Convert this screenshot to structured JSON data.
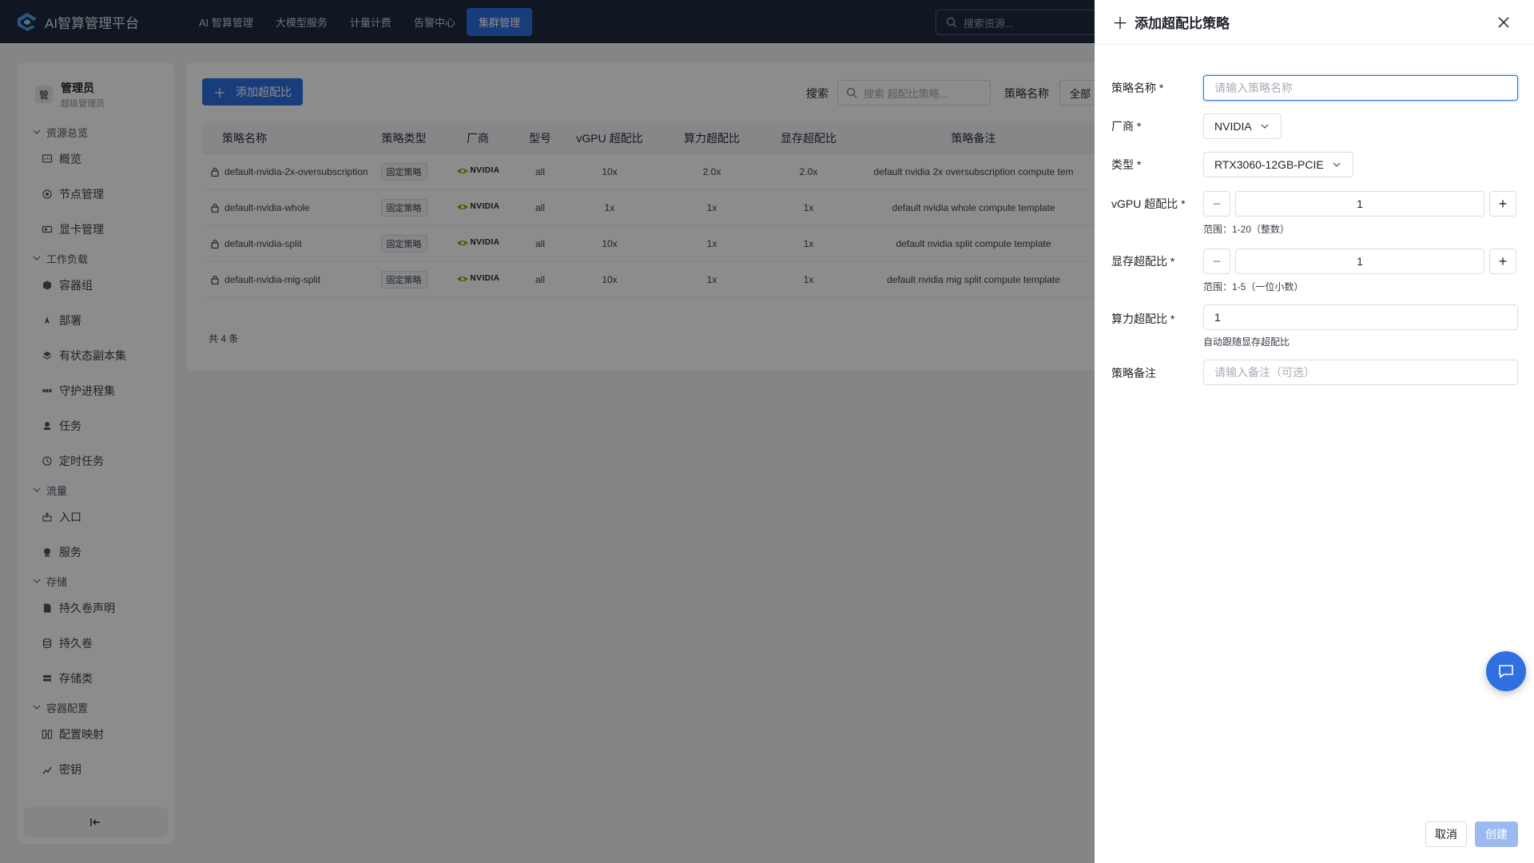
{
  "app": {
    "title": "AI智算管理平台"
  },
  "nav": [
    {
      "label": "AI 智算管理"
    },
    {
      "label": "大模型服务"
    },
    {
      "label": "计量计费"
    },
    {
      "label": "告警中心"
    },
    {
      "label": "集群管理",
      "active": true
    }
  ],
  "top_search": {
    "placeholder": "搜索资源..."
  },
  "user": {
    "avatar": "管",
    "name": "管理员",
    "role": "超级管理员"
  },
  "sidebar": {
    "sections": [
      {
        "label": "资源总览",
        "items": [
          {
            "label": "概览",
            "icon": "grid-icon"
          },
          {
            "label": "节点管理",
            "icon": "node-icon"
          },
          {
            "label": "显卡管理",
            "icon": "gpu-icon"
          }
        ]
      },
      {
        "label": "工作负载",
        "items": [
          {
            "label": "容器组",
            "icon": "cube-icon"
          },
          {
            "label": "部署",
            "icon": "deploy-icon"
          },
          {
            "label": "有状态副本集",
            "icon": "layers-icon"
          },
          {
            "label": "守护进程集",
            "icon": "daemon-icon"
          },
          {
            "label": "任务",
            "icon": "job-icon"
          },
          {
            "label": "定时任务",
            "icon": "clock-icon"
          }
        ]
      },
      {
        "label": "流量",
        "items": [
          {
            "label": "入口",
            "icon": "ingress-icon"
          },
          {
            "label": "服务",
            "icon": "service-icon"
          }
        ]
      },
      {
        "label": "存储",
        "items": [
          {
            "label": "持久卷声明",
            "icon": "file-icon"
          },
          {
            "label": "持久卷",
            "icon": "database-icon"
          },
          {
            "label": "存储类",
            "icon": "storage-icon"
          }
        ]
      },
      {
        "label": "容器配置",
        "items": [
          {
            "label": "配置映射",
            "icon": "config-icon"
          },
          {
            "label": "密钥",
            "icon": "key-icon"
          }
        ]
      }
    ]
  },
  "toolbar": {
    "add_label": "添加超配比",
    "search_label": "搜索",
    "search_placeholder": "搜索 超配比策略...",
    "name_filter_label": "策略名称",
    "name_filter_value": "全部"
  },
  "table": {
    "columns": [
      "策略名称",
      "策略类型",
      "厂商",
      "型号",
      "vGPU 超配比",
      "算力超配比",
      "显存超配比",
      "策略备注"
    ],
    "rows": [
      {
        "name": "default-nvidia-2x-oversubscription",
        "type": "固定策略",
        "vendor": "NVIDIA",
        "model": "all",
        "vgpu": "10x",
        "compute": "2.0x",
        "memory": "2.0x",
        "note": "default nvidia 2x oversubscription compute tem"
      },
      {
        "name": "default-nvidia-whole",
        "type": "固定策略",
        "vendor": "NVIDIA",
        "model": "all",
        "vgpu": "1x",
        "compute": "1x",
        "memory": "1x",
        "note": "default nvidia whole compute template"
      },
      {
        "name": "default-nvidia-split",
        "type": "固定策略",
        "vendor": "NVIDIA",
        "model": "all",
        "vgpu": "10x",
        "compute": "1x",
        "memory": "1x",
        "note": "default nvidia split compute template"
      },
      {
        "name": "default-nvidia-mig-split",
        "type": "固定策略",
        "vendor": "NVIDIA",
        "model": "all",
        "vgpu": "10x",
        "compute": "1x",
        "memory": "1x",
        "note": "default nvidia mig split compute template"
      }
    ],
    "total": "共 4 条"
  },
  "drawer": {
    "title": "添加超配比策略",
    "fields": {
      "name": {
        "label": "策略名称 *",
        "placeholder": "请输入策略名称"
      },
      "vendor": {
        "label": "厂商 *",
        "value": "NVIDIA"
      },
      "type": {
        "label": "类型 *",
        "value": "RTX3060-12GB-PCIE"
      },
      "vgpu": {
        "label": "vGPU 超配比 *",
        "value": "1",
        "hint": "范围：1-20（整数）"
      },
      "memory": {
        "label": "显存超配比 *",
        "value": "1",
        "hint": "范围：1-5（一位小数）"
      },
      "compute": {
        "label": "算力超配比 *",
        "value": "1",
        "hint": "自动跟随显存超配比"
      },
      "note": {
        "label": "策略备注",
        "placeholder": "请输入备注（可选）"
      }
    },
    "cancel_label": "取消",
    "create_label": "创建"
  },
  "colors": {
    "primary": "#2f6fe0",
    "topbar": "#1e2b3f",
    "create_disabled": "#9dbaf0"
  }
}
